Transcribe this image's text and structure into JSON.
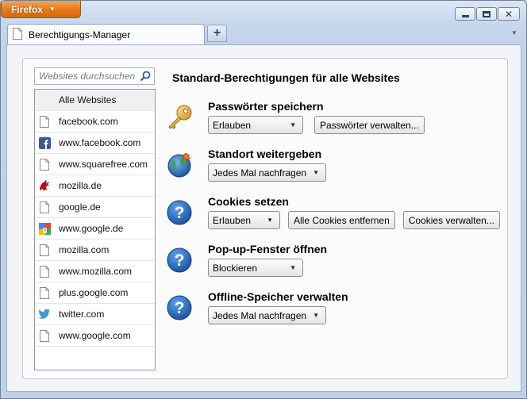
{
  "app": {
    "menu_button_label": "Firefox"
  },
  "tabs": [
    {
      "label": "Berechtigungs-Manager"
    }
  ],
  "search": {
    "placeholder": "Websites durchsuchen"
  },
  "site_list": {
    "all_label": "Alle Websites",
    "items": [
      {
        "label": "facebook.com",
        "icon": "page-icon"
      },
      {
        "label": "www.facebook.com",
        "icon": "facebook-icon"
      },
      {
        "label": "www.squarefree.com",
        "icon": "page-icon"
      },
      {
        "label": "mozilla.de",
        "icon": "mozilla-dino-icon"
      },
      {
        "label": "google.de",
        "icon": "page-icon"
      },
      {
        "label": "www.google.de",
        "icon": "google-icon"
      },
      {
        "label": "mozilla.com",
        "icon": "page-icon"
      },
      {
        "label": "www.mozilla.com",
        "icon": "page-icon"
      },
      {
        "label": "plus.google.com",
        "icon": "page-icon"
      },
      {
        "label": "twitter.com",
        "icon": "twitter-bird-icon"
      },
      {
        "label": "www.google.com",
        "icon": "page-icon"
      }
    ]
  },
  "main": {
    "title": "Standard-Berechtigungen für alle Websites",
    "permissions": {
      "passwords": {
        "title": "Passwörter speichern",
        "icon": "key-icon",
        "selected": "Erlauben",
        "button": "Passwörter verwalten..."
      },
      "location": {
        "title": "Standort weitergeben",
        "icon": "globe-icon",
        "selected": "Jedes Mal nachfragen"
      },
      "cookies": {
        "title": "Cookies setzen",
        "icon": "question-icon",
        "selected": "Erlauben",
        "button_remove": "Alle Cookies entfernen",
        "button_manage": "Cookies verwalten..."
      },
      "popups": {
        "title": "Pop-up-Fenster öffnen",
        "icon": "question-icon",
        "selected": "Blockieren"
      },
      "offline": {
        "title": "Offline-Speicher verwalten",
        "icon": "question-icon",
        "selected": "Jedes Mal nachfragen"
      }
    }
  },
  "colors": {
    "firefox_button": "#e8781a",
    "question_icon": "#1f64b8"
  }
}
